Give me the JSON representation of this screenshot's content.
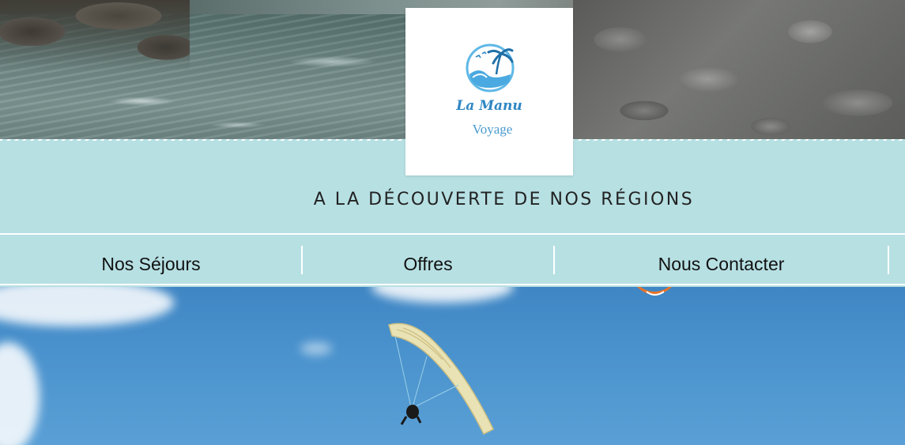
{
  "brand": {
    "name": "La Manu",
    "subtitle": "Voyage"
  },
  "tagline": "A LA DÉCOUVERTE DE NOS RÉGIONS",
  "nav": {
    "items": [
      {
        "label": "Nos Séjours"
      },
      {
        "label": "Offres"
      },
      {
        "label": "Nous Contacter"
      }
    ]
  },
  "colors": {
    "band": "#b7e0e3",
    "logo_blue": "#2f86c3",
    "text": "#222222"
  },
  "icons": {
    "logo": "palm-tree-wave-logo-icon"
  }
}
